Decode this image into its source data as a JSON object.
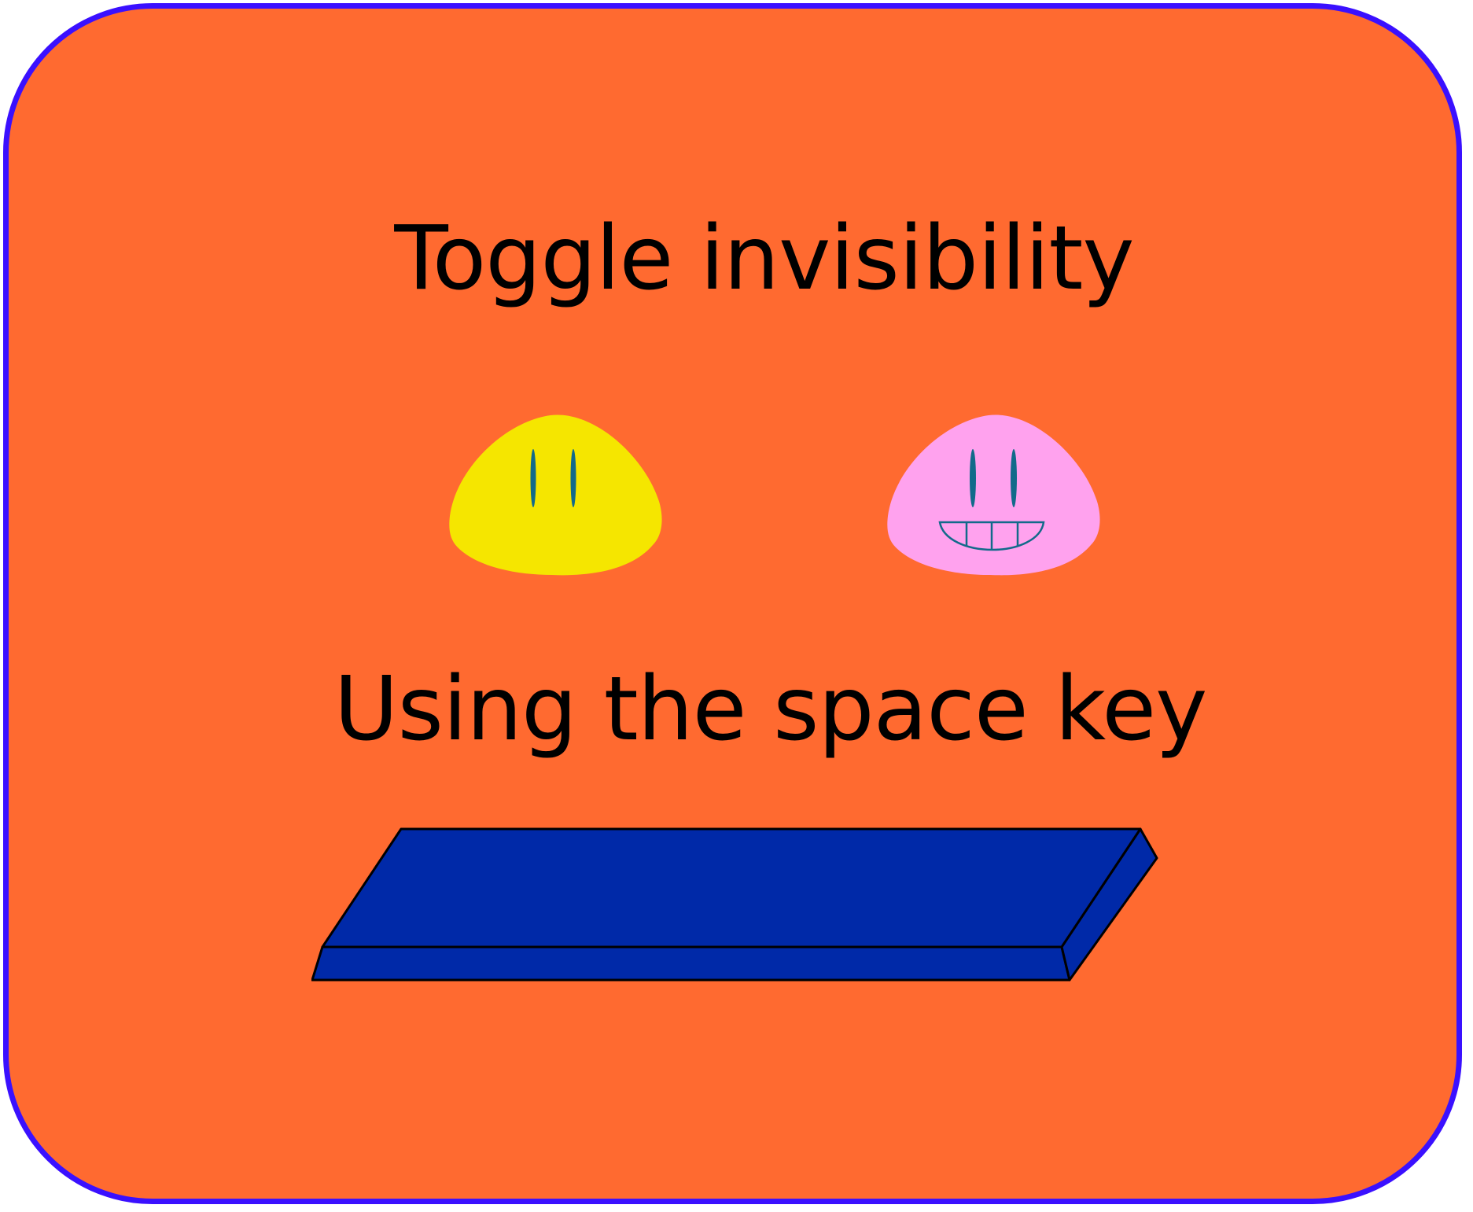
{
  "screen": {
    "title": "Toggle invisibility",
    "subtitle": "Using the space key"
  },
  "characters": [
    {
      "name": "visible-blob",
      "color": "#f5e600",
      "expression": "neutral"
    },
    {
      "name": "grinning-blob",
      "color": "#ffa2ee",
      "expression": "grin"
    }
  ],
  "key": {
    "name": "space-key-icon",
    "top_color": "#0029a8",
    "edge_color": "#000000"
  },
  "theme": {
    "background": "#ff6a30",
    "border": "#3a10ff",
    "eye_color": "#126a8a"
  }
}
